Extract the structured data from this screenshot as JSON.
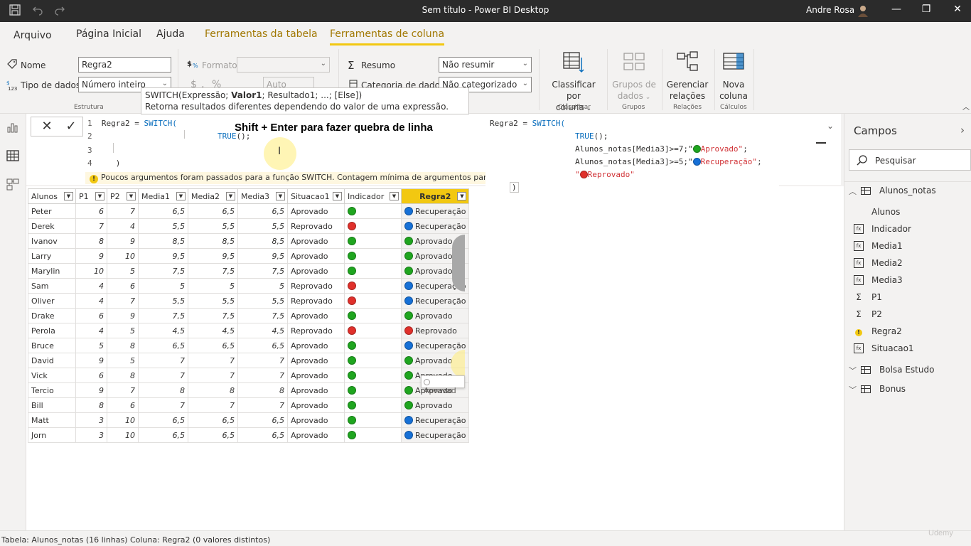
{
  "titlebar": {
    "title": "Sem título - Power BI Desktop",
    "user": "Andre Rosa",
    "save_icon": "save-icon",
    "undo_icon": "undo-icon",
    "redo_icon": "redo-icon",
    "minimize": "—",
    "restore": "❐",
    "close": "✕"
  },
  "ribbon_tabs": [
    "Arquivo",
    "Página Inicial",
    "Ajuda",
    "Ferramentas da tabela",
    "Ferramentas de coluna"
  ],
  "ribbon": {
    "name_label": "Nome",
    "name_value": "Regra2",
    "datatype_label": "Tipo de dados",
    "datatype_value": "Número inteiro",
    "estrutura_label": "Estrutura",
    "formato_label": "Formato",
    "auto_value": "Auto",
    "resumo_label": "Resumo",
    "resumo_value": "Não resumir",
    "categoria_label": "Categoria de dados",
    "categoria_value": "Não categorizado",
    "classificar_btn": "Classificar por",
    "classificar_btn2": "coluna",
    "classificar_group": "Classificar",
    "grupos_btn": "Grupos de",
    "grupos_btn2": "dados",
    "grupos_group": "Grupos",
    "gerenciar_btn": "Gerenciar",
    "gerenciar_btn2": "relações",
    "relacoes_group": "Relações",
    "nova_btn": "Nova",
    "nova_btn2": "coluna",
    "calculos_group": "Cálculos",
    "currency_sym": "$",
    "percent_sym": "%",
    "comma_sym": ","
  },
  "tooltip": {
    "pre": "SWITCH(Expressão; ",
    "bold": "Valor1",
    "post": "; Resultado1; ...; [Else])",
    "desc": "Retorna resultados diferentes dependendo do valor de uma expressão."
  },
  "formula": {
    "line1_num": "1",
    "line1_pre": "Regra2 = ",
    "line1_fn": "SWITCH(",
    "line2_num": "2",
    "line2_fn": "TRUE",
    "line2_rest": "();",
    "line3_num": "3",
    "line4_num": "4",
    "line4_rest": ")",
    "warning": "Poucos argumentos foram passados para a função SWITCH. Contagem mínima de argumentos para a função:",
    "shift_note": "Shift + Enter para fazer quebra de linha",
    "cancel": "✕",
    "commit": "✓"
  },
  "overlay_code": {
    "l1_pre": "Regra2 = ",
    "l1_fn": "SWITCH(",
    "l2_fn": "TRUE",
    "l2_rest": "();",
    "l3_pre": "Alunos_notas[Media3]>=7;\"",
    "l3_str": "Aprovado\"",
    "l3_post": ";",
    "l4_pre": "Alunos_notas[Media3]>=5;\"",
    "l4_str": "Recuperação\"",
    "l4_post": ";",
    "l5_q": "\"",
    "l5_str": "Reprovado\"",
    "l6": ")"
  },
  "table": {
    "columns": [
      "Alunos",
      "P1",
      "P2",
      "Media1",
      "Media2",
      "Media3",
      "Situacao1",
      "Indicador",
      "Regra2"
    ],
    "rows": [
      {
        "aluno": "Peter",
        "p1": "6",
        "p2": "7",
        "m1": "6,5",
        "m2": "6,5",
        "m3": "6,5",
        "sit": "Aprovado",
        "ind": "green",
        "regra": "Recuperação",
        "regra_c": "blue"
      },
      {
        "aluno": "Derek",
        "p1": "7",
        "p2": "4",
        "m1": "5,5",
        "m2": "5,5",
        "m3": "5,5",
        "sit": "Reprovado",
        "ind": "red",
        "regra": "Recuperação",
        "regra_c": "blue"
      },
      {
        "aluno": "Ivanov",
        "p1": "8",
        "p2": "9",
        "m1": "8,5",
        "m2": "8,5",
        "m3": "8,5",
        "sit": "Aprovado",
        "ind": "green",
        "regra": "Aprovado",
        "regra_c": "green"
      },
      {
        "aluno": "Larry",
        "p1": "9",
        "p2": "10",
        "m1": "9,5",
        "m2": "9,5",
        "m3": "9,5",
        "sit": "Aprovado",
        "ind": "green",
        "regra": "Aprovado",
        "regra_c": "green"
      },
      {
        "aluno": "Marylin",
        "p1": "10",
        "p2": "5",
        "m1": "7,5",
        "m2": "7,5",
        "m3": "7,5",
        "sit": "Aprovado",
        "ind": "green",
        "regra": "Aprovado",
        "regra_c": "green"
      },
      {
        "aluno": "Sam",
        "p1": "4",
        "p2": "6",
        "m1": "5",
        "m2": "5",
        "m3": "5",
        "sit": "Reprovado",
        "ind": "red",
        "regra": "Recuperação",
        "regra_c": "blue"
      },
      {
        "aluno": "Oliver",
        "p1": "4",
        "p2": "7",
        "m1": "5,5",
        "m2": "5,5",
        "m3": "5,5",
        "sit": "Reprovado",
        "ind": "red",
        "regra": "Recuperação",
        "regra_c": "blue"
      },
      {
        "aluno": "Drake",
        "p1": "6",
        "p2": "9",
        "m1": "7,5",
        "m2": "7,5",
        "m3": "7,5",
        "sit": "Aprovado",
        "ind": "green",
        "regra": "Aprovado",
        "regra_c": "green"
      },
      {
        "aluno": "Perola",
        "p1": "4",
        "p2": "5",
        "m1": "4,5",
        "m2": "4,5",
        "m3": "4,5",
        "sit": "Reprovado",
        "ind": "red",
        "regra": "Reprovado",
        "regra_c": "red"
      },
      {
        "aluno": "Bruce",
        "p1": "5",
        "p2": "8",
        "m1": "6,5",
        "m2": "6,5",
        "m3": "6,5",
        "sit": "Aprovado",
        "ind": "green",
        "regra": "Recuperação",
        "regra_c": "blue"
      },
      {
        "aluno": "David",
        "p1": "9",
        "p2": "5",
        "m1": "7",
        "m2": "7",
        "m3": "7",
        "sit": "Aprovado",
        "ind": "green",
        "regra": "Aprovado",
        "regra_c": "green"
      },
      {
        "aluno": "Vick",
        "p1": "6",
        "p2": "8",
        "m1": "7",
        "m2": "7",
        "m3": "7",
        "sit": "Aprovado",
        "ind": "green",
        "regra": "Aprovado",
        "regra_c": "green"
      },
      {
        "aluno": "Tercio",
        "p1": "9",
        "p2": "7",
        "m1": "8",
        "m2": "8",
        "m3": "8",
        "sit": "Aprovado",
        "ind": "green",
        "regra": "Aprovado",
        "regra_c": "green"
      },
      {
        "aluno": "Bill",
        "p1": "8",
        "p2": "6",
        "m1": "7",
        "m2": "7",
        "m3": "7",
        "sit": "Aprovado",
        "ind": "green",
        "regra": "Aprovado",
        "regra_c": "green"
      },
      {
        "aluno": "Matt",
        "p1": "3",
        "p2": "10",
        "m1": "6,5",
        "m2": "6,5",
        "m3": "6,5",
        "sit": "Aprovado",
        "ind": "green",
        "regra": "Recuperação",
        "regra_c": "blue"
      },
      {
        "aluno": "Jorn",
        "p1": "3",
        "p2": "10",
        "m1": "6,5",
        "m2": "6,5",
        "m3": "6,5",
        "sit": "Aprovado",
        "ind": "green",
        "regra": "Recuperação",
        "regra_c": "blue"
      }
    ],
    "hover_tip": "Aprovad"
  },
  "colors": {
    "green": "#1fa51f",
    "red": "#e0302b",
    "blue": "#1670d6",
    "accent": "#f2c811"
  },
  "fields": {
    "title": "Campos",
    "search_placeholder": "Pesquisar",
    "table1": "Alunos_notas",
    "items": [
      {
        "label": "Alunos",
        "icon": "none"
      },
      {
        "label": "Indicador",
        "icon": "calc"
      },
      {
        "label": "Media1",
        "icon": "calc"
      },
      {
        "label": "Media2",
        "icon": "calc"
      },
      {
        "label": "Media3",
        "icon": "calc"
      },
      {
        "label": "P1",
        "icon": "sigma"
      },
      {
        "label": "P2",
        "icon": "sigma"
      },
      {
        "label": "Regra2",
        "icon": "warn"
      },
      {
        "label": "Situacao1",
        "icon": "calc"
      }
    ],
    "table2": "Bolsa Estudo",
    "table3": "Bonus"
  },
  "statusbar": {
    "text": "Tabela: Alunos_notas (16 linhas) Coluna: Regra2 (0 valores distintos)"
  },
  "watermark": "Udemy"
}
